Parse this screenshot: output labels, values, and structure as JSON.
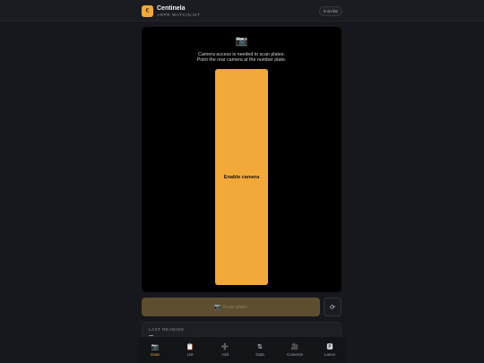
{
  "header": {
    "logo_glyph": "€",
    "title": "Centinela",
    "subtitle": "ANPR WATCHLIST",
    "count_badge": "0 on list"
  },
  "camera": {
    "icon": "camera-icon",
    "icon_glyph": "📷",
    "message_line1": "Camera access is needed to scan plates.",
    "message_line2": "Point the rear camera at the number plate.",
    "enable_label": "Enable camera"
  },
  "scan": {
    "icon_glyph": "📷",
    "label": "Scan plate",
    "refresh_glyph": "⟳"
  },
  "last_reading": {
    "label": "LAST READING",
    "value": ""
  },
  "nav": {
    "items": [
      {
        "icon": "📷",
        "label": "Scan",
        "active": true
      },
      {
        "icon": "📋",
        "label": "List"
      },
      {
        "icon": "➕",
        "label": "Add"
      },
      {
        "icon": "⇅",
        "label": "Data"
      },
      {
        "icon": "🎥",
        "label": "Cameras"
      },
      {
        "icon": "🅿",
        "label": "Lanes"
      }
    ]
  },
  "colors": {
    "accent": "#f3a93a",
    "background": "#17181d",
    "camera_bg": "#000000",
    "scan_disabled": "#5c4e2e"
  }
}
